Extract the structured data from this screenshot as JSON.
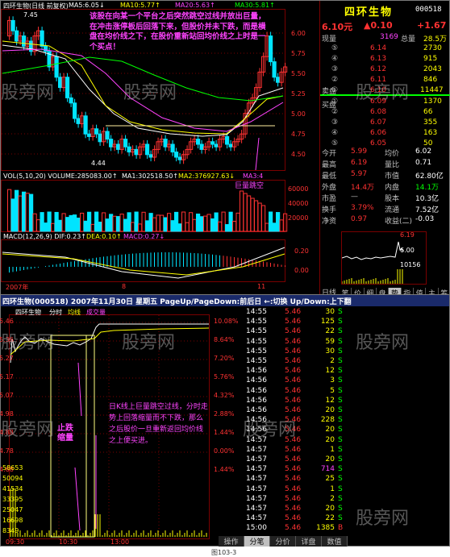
{
  "upper": {
    "title": "四环生物(日线 前复权)",
    "ma5": "MA5:6.05↓",
    "ma10": "MA10:5.77↑",
    "ma20": "MA20:5.63↑",
    "ma30": "MA30:5.81↑",
    "high_label": "7.45",
    "low_label": "4.44",
    "price_ticks": [
      "6.00",
      "5.75",
      "5.50",
      "5.25",
      "5.00",
      "4.75",
      "4.50"
    ],
    "vol_title": "VOL(5,10,20)  VOLUME:285083.00↑",
    "vol_ma1": "MA1:302518.50↑",
    "vol_ma2": "MA2:376927.63↓",
    "vol_ma3": "MA3:4",
    "vol_ticks": [
      "60000",
      "40000",
      "20000"
    ],
    "macd_title": "MACD(12,26,9)  DIF:0.23↑",
    "dea": "DEA:0.10↑",
    "macd": "MACD:0.27↓",
    "macd_ticks": [
      "0.20",
      "0.00"
    ],
    "dates": [
      "2007年",
      "8",
      "11"
    ],
    "annotation_top": "该股在向某一个平台之后突然跳空过线并放出巨量，在冲击涨停板后回落下来，但股价并未下跌，而是横盘在均价线之下，在股价重新站回均价线之上时是一个买点！",
    "annotation_gap": "巨量跳空"
  },
  "quote": {
    "name": "四环生物",
    "code": "000518",
    "price": "6.10元",
    "change": "▲0.10",
    "change_pct": "+1.67",
    "current_hand_label": "现量",
    "current_hand": "3169",
    "total_label": "总量",
    "total": "28.5万",
    "sell_label": "卖盘",
    "buy_label": "买盘",
    "asks": [
      {
        "n": "⑤",
        "p": "6.14",
        "v": "2730"
      },
      {
        "n": "④",
        "p": "6.13",
        "v": "915"
      },
      {
        "n": "③",
        "p": "6.12",
        "v": "2043"
      },
      {
        "n": "②",
        "p": "6.11",
        "v": "846"
      },
      {
        "n": "①",
        "p": "6.10",
        "v": "11447"
      }
    ],
    "bids": [
      {
        "n": "①",
        "p": "6.09",
        "v": "1370"
      },
      {
        "n": "②",
        "p": "6.08",
        "v": "66"
      },
      {
        "n": "③",
        "p": "6.07",
        "v": "355"
      },
      {
        "n": "④",
        "p": "6.06",
        "v": "163"
      },
      {
        "n": "⑤",
        "p": "6.05",
        "v": "50"
      }
    ],
    "stats": [
      {
        "l1": "今开",
        "v1": "5.99",
        "l2": "均价",
        "v2": "6.02"
      },
      {
        "l1": "最高",
        "v1": "6.19",
        "l2": "量比",
        "v2": "0.71"
      },
      {
        "l1": "最低",
        "v1": "5.97",
        "l2": "市值",
        "v2": "62.80亿"
      },
      {
        "l1": "外盘",
        "v1": "14.4万",
        "l2": "内盘",
        "v2": "14.1万"
      },
      {
        "l1": "市盈",
        "v1": "—",
        "l2": "股本",
        "v2": "10.3亿"
      },
      {
        "l1": "换手",
        "v1": "3.79%",
        "l2": "流通",
        "v2": "7.52亿"
      },
      {
        "l1": "净资",
        "v1": "0.97",
        "l2": "收益(二)",
        "v2": "-0.03"
      }
    ],
    "mini_high": "6.19",
    "mini_mid": "6.00",
    "mini_vol": "10156",
    "tabs": [
      "笔",
      "价",
      "细",
      "盘",
      "势",
      "指",
      "值",
      "主",
      "筹"
    ]
  },
  "lower": {
    "window_title": "四环生物(000518) 2007年11月30日 星期五 PageUp/PageDown:前后日 ←:切换 Up/Down:上下翻",
    "legend_name": "四环生物",
    "legend_fs": "分时",
    "legend_avg": "均线",
    "legend_vol": "成交量",
    "price_ticks": [
      "5.46",
      "5.36",
      "5.27",
      "5.17",
      "5.07",
      "4.98",
      "4.88",
      "4.78",
      "4.68"
    ],
    "pct_ticks": [
      "10.08%",
      "8.64%",
      "7.20%",
      "5.76%",
      "4.32%",
      "2.88%",
      "1.44%",
      "0.00%",
      "1.44%"
    ],
    "vol_ticks": [
      "58653",
      "50094",
      "41534",
      "33395",
      "25047",
      "16698",
      "8349"
    ],
    "time_ticks": [
      "09:30",
      "10:30",
      "13:00"
    ],
    "annotation_stop": "止跌缩量",
    "annotation_main": "日K线上巨量跳空过线，分时走势上回落缩量而不下跌，那么之后股价一旦重新返回均价线之上便买进。",
    "ticks": [
      {
        "t": "14:55",
        "p": "5.46",
        "v": "30",
        "s": "S"
      },
      {
        "t": "14:55",
        "p": "5.46",
        "v": "125",
        "s": "S"
      },
      {
        "t": "14:55",
        "p": "5.46",
        "v": "22",
        "s": "S"
      },
      {
        "t": "14:55",
        "p": "5.46",
        "v": "59",
        "s": "S"
      },
      {
        "t": "14:55",
        "p": "5.46",
        "v": "30",
        "s": "S"
      },
      {
        "t": "14:55",
        "p": "5.46",
        "v": "2",
        "s": "S"
      },
      {
        "t": "14:56",
        "p": "5.46",
        "v": "12",
        "s": "S"
      },
      {
        "t": "14:56",
        "p": "5.46",
        "v": "3",
        "s": "S"
      },
      {
        "t": "14:56",
        "p": "5.46",
        "v": "5",
        "s": "S"
      },
      {
        "t": "14:56",
        "p": "5.46",
        "v": "12",
        "s": "S"
      },
      {
        "t": "14:56",
        "p": "5.46",
        "v": "20",
        "s": "S"
      },
      {
        "t": "14:56",
        "p": "5.46",
        "v": "228",
        "s": "S"
      },
      {
        "t": "14:56",
        "p": "5.46",
        "v": "20",
        "s": "S"
      },
      {
        "t": "14:57",
        "p": "5.46",
        "v": "20",
        "s": "S"
      },
      {
        "t": "14:57",
        "p": "5.46",
        "v": "1",
        "s": "S"
      },
      {
        "t": "14:57",
        "p": "5.46",
        "v": "20",
        "s": "S"
      },
      {
        "t": "14:57",
        "p": "5.46",
        "v": "714",
        "s": "S"
      },
      {
        "t": "14:57",
        "p": "5.46",
        "v": "25",
        "s": "S"
      },
      {
        "t": "14:57",
        "p": "5.46",
        "v": "1",
        "s": "S"
      },
      {
        "t": "14:57",
        "p": "5.46",
        "v": "2",
        "s": "S"
      },
      {
        "t": "14:57",
        "p": "5.46",
        "v": "20",
        "s": "S"
      },
      {
        "t": "14:57",
        "p": "5.46",
        "v": "22",
        "s": "S"
      },
      {
        "t": "15:00",
        "p": "5.46",
        "v": "1385",
        "s": "B"
      }
    ],
    "bottom_tabs": [
      "操作",
      "分笔",
      "分价",
      "详盘",
      "数值"
    ]
  },
  "side_label": "日线",
  "watermark": "股旁网",
  "caption": "图103-3",
  "colors": {
    "up": "#ff3232",
    "down": "#00e4ff",
    "yellow": "#ffff00",
    "gold": "#ffcc00",
    "magenta": "#ff44ff",
    "green": "#00ff00",
    "white": "#ffffff",
    "grid": "#7a0000"
  }
}
